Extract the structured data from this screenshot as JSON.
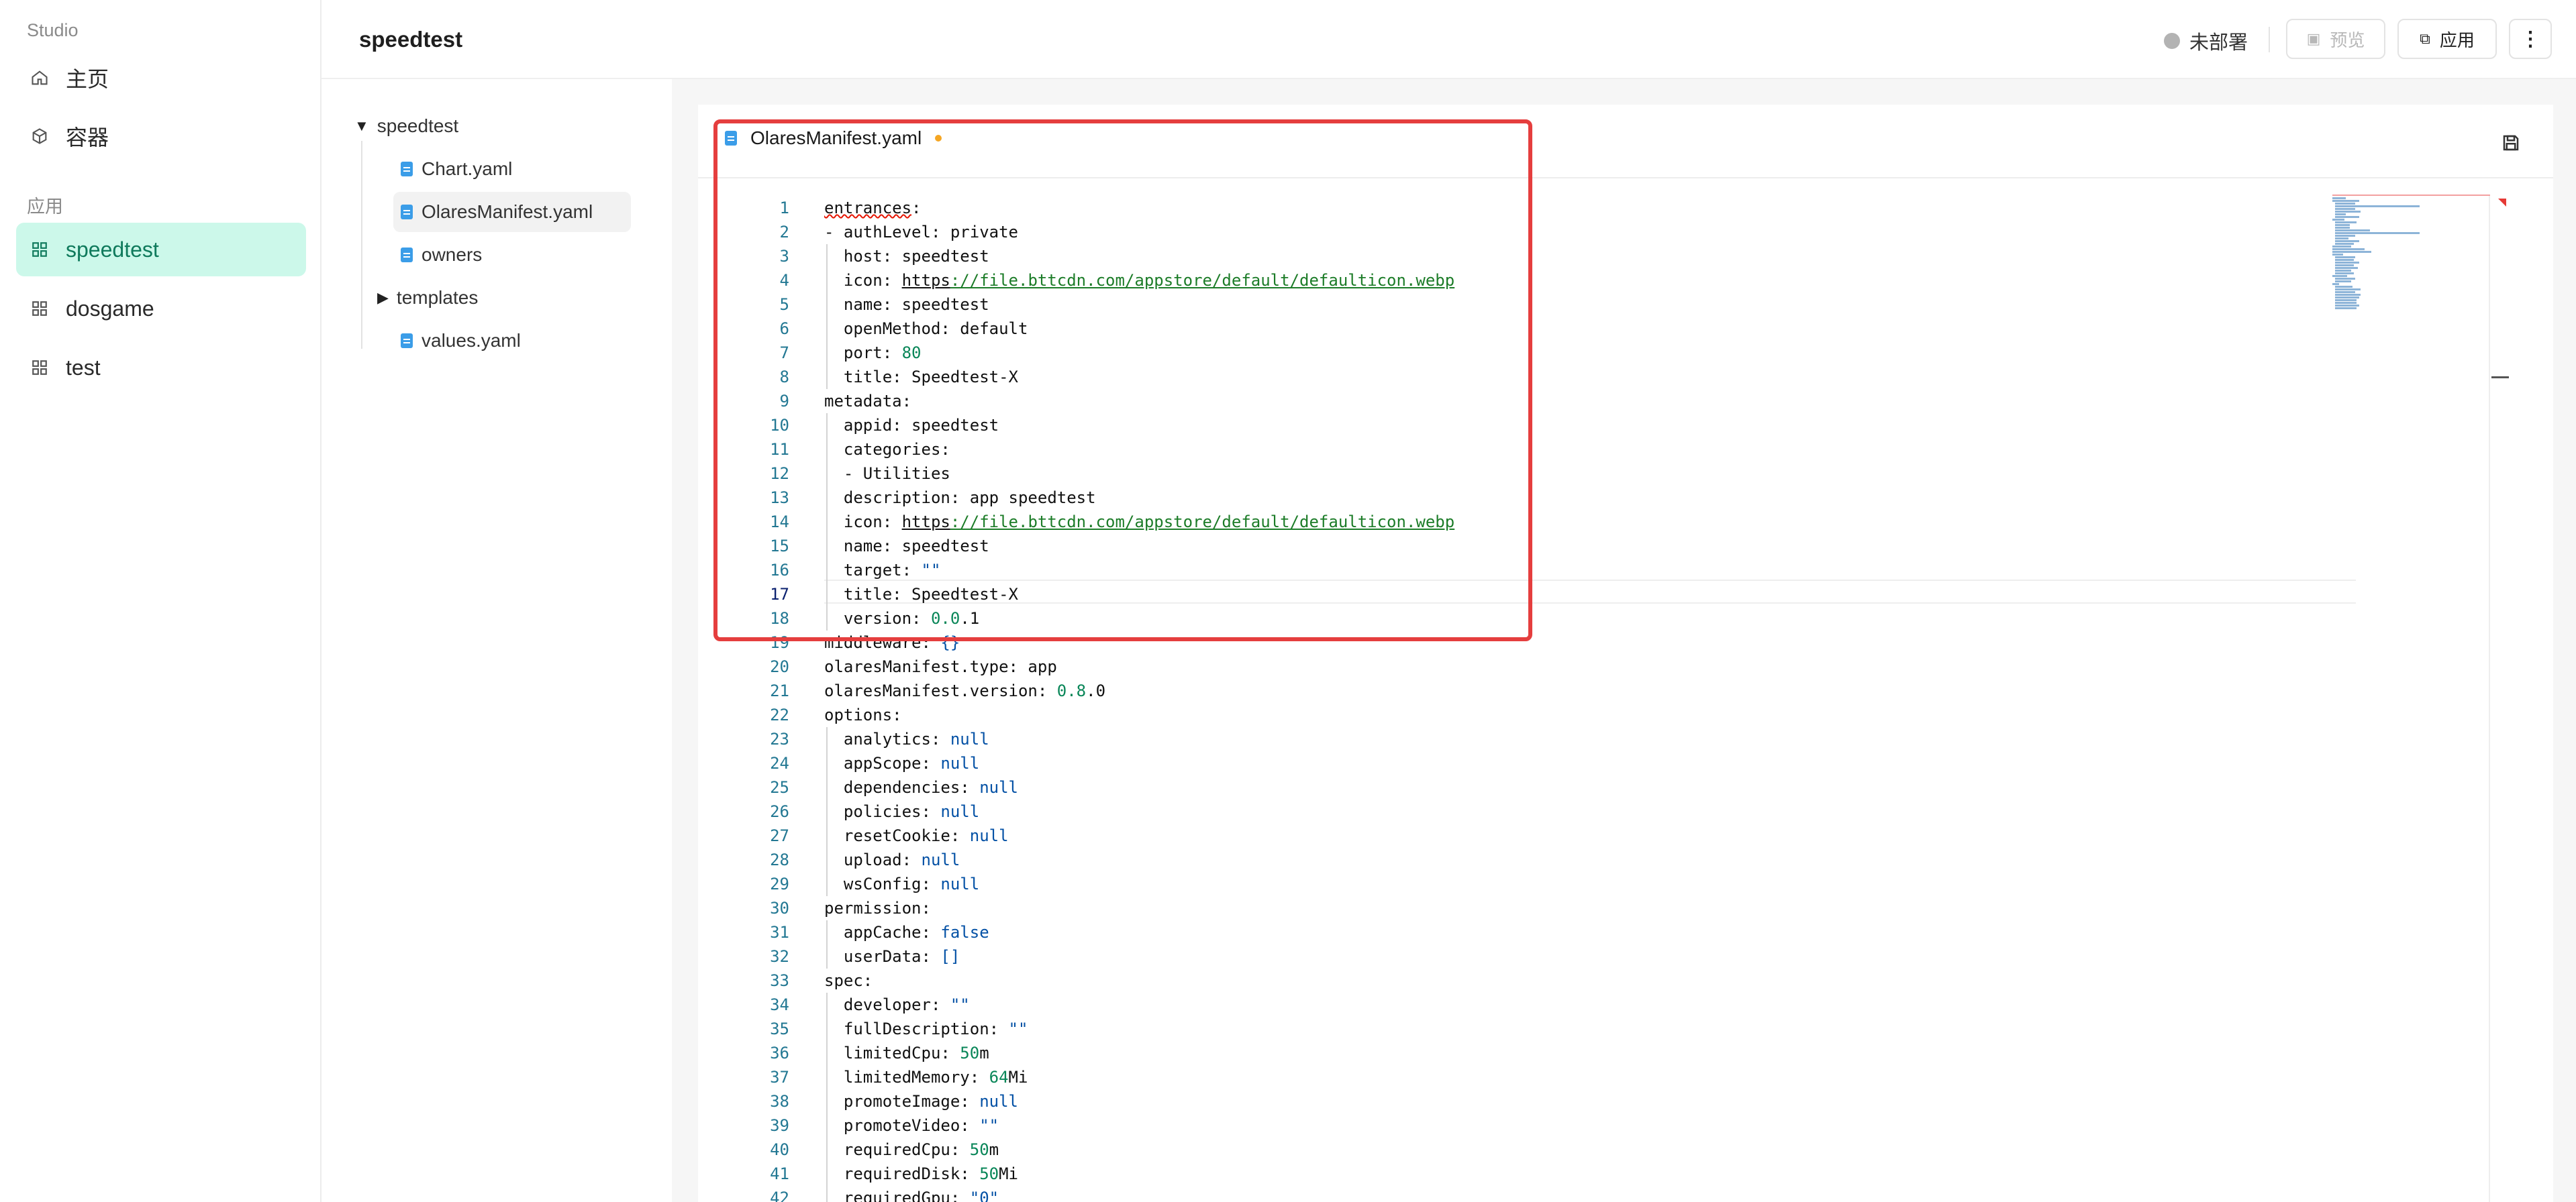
{
  "sidebar": {
    "studio_label": "Studio",
    "nav": [
      {
        "label": "主页",
        "icon": "home-icon"
      },
      {
        "label": "容器",
        "icon": "cube-icon"
      }
    ],
    "apps_section_label": "应用",
    "apps": [
      {
        "label": "speedtest",
        "icon": "grid-icon",
        "active": true
      },
      {
        "label": "dosgame",
        "icon": "grid-icon",
        "active": false
      },
      {
        "label": "test",
        "icon": "grid-icon",
        "active": false
      }
    ]
  },
  "header": {
    "title": "speedtest",
    "status_label": "未部署",
    "preview_label": "预览",
    "apply_label": "应用",
    "more_label": "⋮"
  },
  "file_tree": {
    "root": "speedtest",
    "items": [
      {
        "label": "Chart.yaml",
        "type": "file"
      },
      {
        "label": "OlaresManifest.yaml",
        "type": "file",
        "selected": true
      },
      {
        "label": "owners",
        "type": "file"
      },
      {
        "label": "templates",
        "type": "folder"
      },
      {
        "label": "values.yaml",
        "type": "file"
      }
    ]
  },
  "editor": {
    "tab_label": "OlaresManifest.yaml",
    "current_line": 17,
    "lines": [
      "entrances:",
      "- authLevel: private",
      "  host: speedtest",
      "  icon: https://file.bttcdn.com/appstore/default/defaulticon.webp",
      "  name: speedtest",
      "  openMethod: default",
      "  port: 80",
      "  title: Speedtest-X",
      "metadata:",
      "  appid: speedtest",
      "  categories:",
      "  - Utilities",
      "  description: app speedtest",
      "  icon: https://file.bttcdn.com/appstore/default/defaulticon.webp",
      "  name: speedtest",
      "  target: \"\"",
      "  title: Speedtest-X",
      "  version: 0.0.1",
      "middleware: {}",
      "olaresManifest.type: app",
      "olaresManifest.version: 0.8.0",
      "options:",
      "  analytics: null",
      "  appScope: null",
      "  dependencies: null",
      "  policies: null",
      "  resetCookie: null",
      "  upload: null",
      "  wsConfig: null",
      "permission:",
      "  appCache: false",
      "  userData: []",
      "spec:",
      "  developer: \"\"",
      "  fullDescription: \"\"",
      "  limitedCpu: 50m",
      "  limitedMemory: 64Mi",
      "  promoteImage: null",
      "  promoteVideo: \"\"",
      "  requiredCpu: 50m",
      "  requiredDisk: 50Mi",
      "  requiredGpu: \"0\""
    ]
  },
  "colors": {
    "accent_bg": "#ccf8ea",
    "accent_text": "#0f7a5c",
    "highlight_border": "#e53e3e",
    "line_number": "#237893",
    "number": "#098658",
    "keyword": "#0451a5",
    "url": "#1c7c28"
  }
}
